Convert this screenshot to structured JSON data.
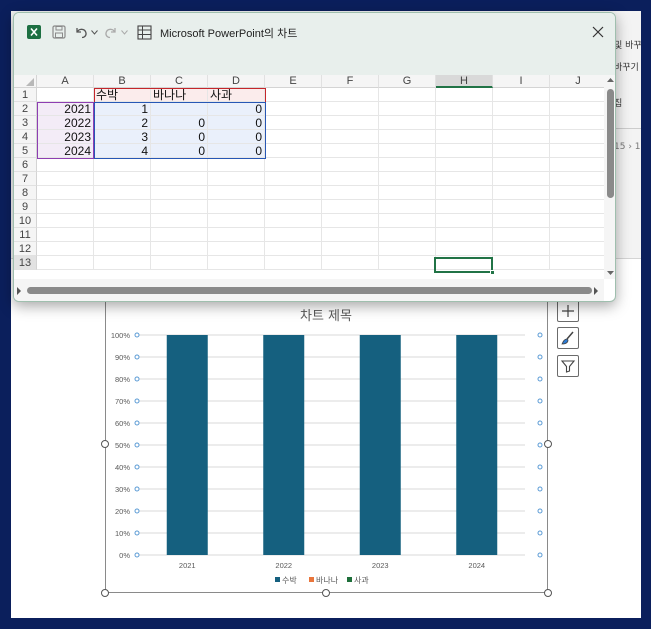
{
  "background": {
    "ribbon_fragments": [
      "및 바꾸",
      "바꾸기",
      "집",
      "15 › 1"
    ]
  },
  "excel": {
    "window_title": "Microsoft PowerPoint의 차트",
    "icons": {
      "app": "excel-icon",
      "save": "save-icon",
      "undo": "undo-icon",
      "redo": "redo-icon",
      "edit_data": "edit-data-icon",
      "close": "close-icon"
    },
    "columns": [
      "A",
      "B",
      "C",
      "D",
      "E",
      "F",
      "G",
      "H",
      "I",
      "J"
    ],
    "selected_column": "H",
    "rows": [
      "1",
      "2",
      "3",
      "4",
      "5",
      "6",
      "7",
      "8",
      "9",
      "10",
      "11",
      "12",
      "13"
    ],
    "selected_row": "13",
    "header_row": [
      "",
      "수박",
      "바나나",
      "사과"
    ],
    "data_rows": [
      [
        "2021",
        "1",
        "",
        "0"
      ],
      [
        "2022",
        "2",
        "0",
        "0"
      ],
      [
        "2023",
        "3",
        "0",
        "0"
      ],
      [
        "2024",
        "4",
        "0",
        "0"
      ]
    ]
  },
  "chart_data": {
    "type": "bar",
    "stacked": "percent",
    "title": "차트 제목",
    "categories": [
      "2021",
      "2022",
      "2023",
      "2024"
    ],
    "series": [
      {
        "name": "수박",
        "values": [
          1,
          2,
          3,
          4
        ],
        "color": "#15607f"
      },
      {
        "name": "바나나",
        "values": [
          0,
          0,
          0,
          0
        ],
        "color": "#e9753b"
      },
      {
        "name": "사과",
        "values": [
          0,
          0,
          0,
          0
        ],
        "color": "#1e6f3a"
      }
    ],
    "y_ticks": [
      "0%",
      "10%",
      "20%",
      "30%",
      "40%",
      "50%",
      "60%",
      "70%",
      "80%",
      "90%",
      "100%"
    ],
    "ylim": [
      0,
      1
    ],
    "grid": true,
    "legend": "bottom"
  },
  "chart_tools": {
    "elements": "chart-elements-plus-icon",
    "styles": "chart-styles-brush-icon",
    "filters": "chart-filters-funnel-icon"
  }
}
